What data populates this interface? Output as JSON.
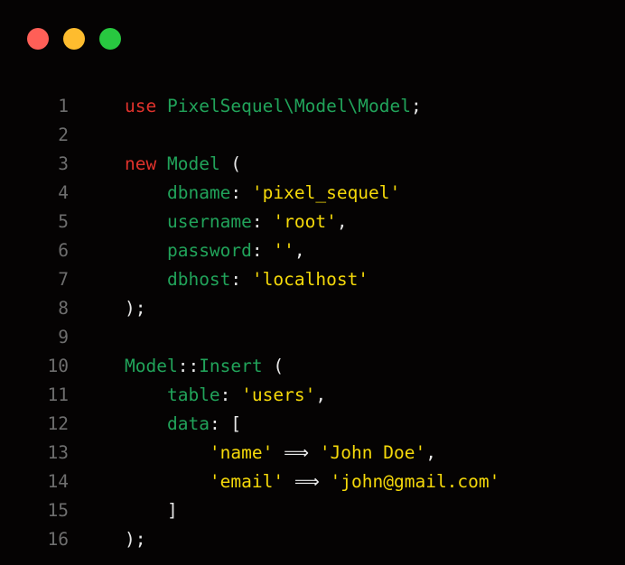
{
  "window": {
    "controls": {
      "close_color": "#ff5f57",
      "minimize_color": "#febc2e",
      "maximize_color": "#28c840"
    }
  },
  "code": {
    "lines": [
      {
        "n": "1",
        "tokens": [
          {
            "t": "use",
            "k": "kw"
          },
          {
            "t": " ",
            "k": "pun"
          },
          {
            "t": "PixelSequel\\Model\\Model",
            "k": "cls"
          },
          {
            "t": ";",
            "k": "pun"
          }
        ]
      },
      {
        "n": "2",
        "tokens": []
      },
      {
        "n": "3",
        "tokens": [
          {
            "t": "new",
            "k": "kw"
          },
          {
            "t": " ",
            "k": "pun"
          },
          {
            "t": "Model",
            "k": "cls"
          },
          {
            "t": " (",
            "k": "pun"
          }
        ]
      },
      {
        "n": "4",
        "tokens": [
          {
            "t": "    ",
            "k": "pun"
          },
          {
            "t": "dbname",
            "k": "key"
          },
          {
            "t": ": ",
            "k": "pun"
          },
          {
            "t": "'pixel_sequel'",
            "k": "str"
          }
        ]
      },
      {
        "n": "5",
        "tokens": [
          {
            "t": "    ",
            "k": "pun"
          },
          {
            "t": "username",
            "k": "key"
          },
          {
            "t": ": ",
            "k": "pun"
          },
          {
            "t": "'root'",
            "k": "str"
          },
          {
            "t": ",",
            "k": "pun"
          }
        ]
      },
      {
        "n": "6",
        "tokens": [
          {
            "t": "    ",
            "k": "pun"
          },
          {
            "t": "password",
            "k": "key"
          },
          {
            "t": ": ",
            "k": "pun"
          },
          {
            "t": "''",
            "k": "str"
          },
          {
            "t": ",",
            "k": "pun"
          }
        ]
      },
      {
        "n": "7",
        "tokens": [
          {
            "t": "    ",
            "k": "pun"
          },
          {
            "t": "dbhost",
            "k": "key"
          },
          {
            "t": ": ",
            "k": "pun"
          },
          {
            "t": "'localhost'",
            "k": "str"
          }
        ]
      },
      {
        "n": "8",
        "tokens": [
          {
            "t": ");",
            "k": "pun"
          }
        ]
      },
      {
        "n": "9",
        "tokens": []
      },
      {
        "n": "10",
        "tokens": [
          {
            "t": "Model",
            "k": "cls"
          },
          {
            "t": "::",
            "k": "pun"
          },
          {
            "t": "Insert",
            "k": "cls"
          },
          {
            "t": " (",
            "k": "pun"
          }
        ]
      },
      {
        "n": "11",
        "tokens": [
          {
            "t": "    ",
            "k": "pun"
          },
          {
            "t": "table",
            "k": "key"
          },
          {
            "t": ": ",
            "k": "pun"
          },
          {
            "t": "'users'",
            "k": "str"
          },
          {
            "t": ",",
            "k": "pun"
          }
        ]
      },
      {
        "n": "12",
        "tokens": [
          {
            "t": "    ",
            "k": "pun"
          },
          {
            "t": "data",
            "k": "key"
          },
          {
            "t": ": [",
            "k": "pun"
          }
        ]
      },
      {
        "n": "13",
        "tokens": [
          {
            "t": "        ",
            "k": "pun"
          },
          {
            "t": "'name'",
            "k": "str"
          },
          {
            "t": " ⟹ ",
            "k": "pun"
          },
          {
            "t": "'John Doe'",
            "k": "str"
          },
          {
            "t": ",",
            "k": "pun"
          }
        ]
      },
      {
        "n": "14",
        "tokens": [
          {
            "t": "        ",
            "k": "pun"
          },
          {
            "t": "'email'",
            "k": "str"
          },
          {
            "t": " ⟹ ",
            "k": "pun"
          },
          {
            "t": "'john@gmail.com'",
            "k": "str"
          }
        ]
      },
      {
        "n": "15",
        "tokens": [
          {
            "t": "    ]",
            "k": "pun"
          }
        ]
      },
      {
        "n": "16",
        "tokens": [
          {
            "t": ");",
            "k": "pun"
          }
        ]
      }
    ]
  }
}
